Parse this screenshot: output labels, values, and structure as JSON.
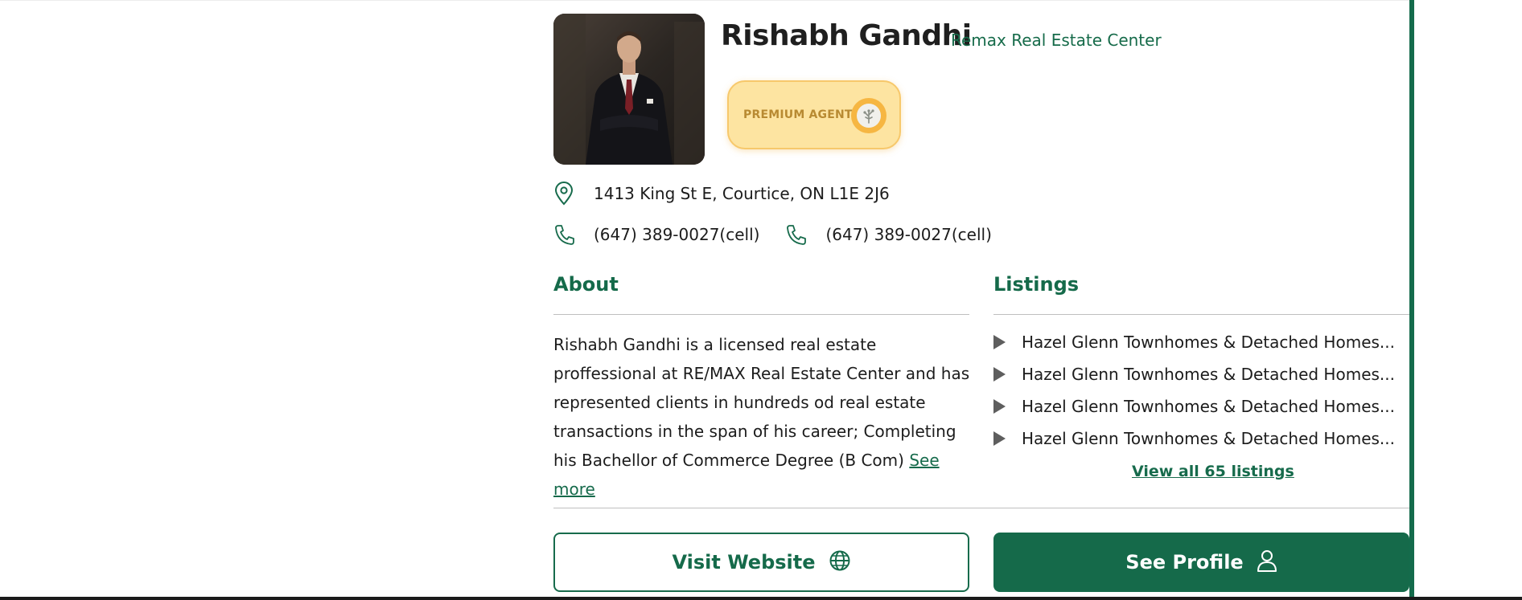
{
  "agent": {
    "name": "Rishabh Gandhi",
    "brokerage": "Remax Real Estate Center",
    "badge_label": "PREMIUM AGENT",
    "address": "1413 King St E, Courtice, ON L1E 2J6",
    "phones": [
      "(647) 389-0027(cell)",
      "(647) 389-0027(cell)"
    ]
  },
  "about": {
    "title": "About",
    "text": "Rishabh Gandhi is a licensed real estate proffessional at RE/MAX Real Estate Center and has represented clients in hundreds od real estate transactions in the span of his career; Completing his Bachellor of Commerce Degree (B Com)",
    "see_more": "See more"
  },
  "listings": {
    "title": "Listings",
    "items": [
      "Hazel Glenn Townhomes & Detached Homes...",
      "Hazel Glenn Townhomes & Detached Homes...",
      "Hazel Glenn Townhomes & Detached Homes...",
      "Hazel Glenn Townhomes & Detached Homes..."
    ],
    "view_all": "View all 65 listings"
  },
  "actions": {
    "visit_website": "Visit Website",
    "see_profile": "See Profile"
  },
  "colors": {
    "brand_green": "#156a4a",
    "badge_gold": "#fde4a1",
    "medal_orange": "#f6b642"
  },
  "icons": {
    "address": "map-pin-icon",
    "phone": "phone-icon",
    "website": "globe-icon",
    "profile": "user-icon",
    "listing_marker": "play-triangle-icon",
    "badge": "medal-icon"
  }
}
